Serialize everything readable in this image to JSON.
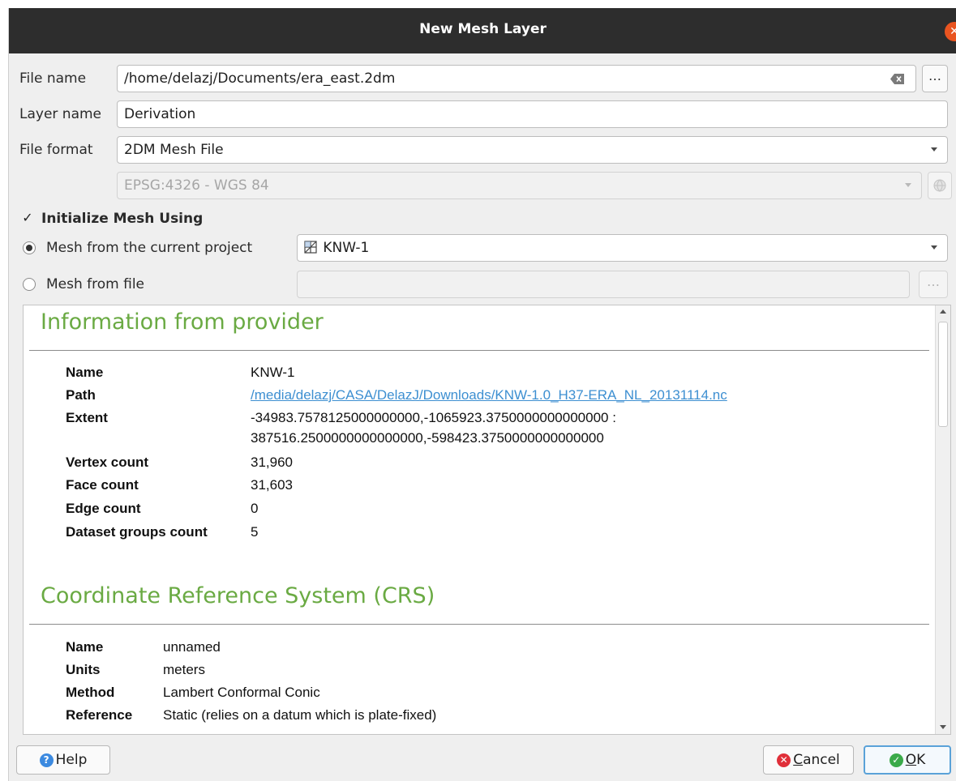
{
  "window": {
    "title": "New Mesh Layer"
  },
  "form": {
    "file_name_label": "File name",
    "file_name_value": "/home/delazj/Documents/era_east.2dm",
    "browse_label": "…",
    "layer_name_label": "Layer name",
    "layer_name_value": "Derivation",
    "file_format_label": "File format",
    "file_format_value": "2DM Mesh File",
    "crs_value": "EPSG:4326 - WGS 84",
    "initialize_label": "Initialize Mesh Using",
    "initialize_checked": true,
    "mesh_project_label": "Mesh from the current project",
    "mesh_project_value": "KNW-1",
    "mesh_file_label": "Mesh from file",
    "mesh_file_browse": "…",
    "checkbox_glyph": "✓"
  },
  "info": {
    "provider_title": "Information from provider",
    "provider_rows": [
      {
        "key": "Name",
        "value": "KNW-1"
      },
      {
        "key": "Path",
        "value": "/media/delazj/CASA/DelazJ/Downloads/KNW-1.0_H37-ERA_NL_20131114.nc"
      },
      {
        "key": "Extent",
        "value": "-34983.7578125000000000,-1065923.3750000000000000 :",
        "value2": "387516.2500000000000000,-598423.3750000000000000"
      },
      {
        "key": "Vertex count",
        "value": "31,960"
      },
      {
        "key": "Face count",
        "value": "31,603"
      },
      {
        "key": "Edge count",
        "value": "0"
      },
      {
        "key": "Dataset groups count",
        "value": "5"
      }
    ],
    "crs_title": "Coordinate Reference System (CRS)",
    "crs_rows": [
      {
        "key": "Name",
        "value": "unnamed"
      },
      {
        "key": "Units",
        "value": "meters"
      },
      {
        "key": "Method",
        "value": "Lambert Conformal Conic"
      },
      {
        "key": "Reference",
        "value": "Static (relies on a datum which is plate-fixed)"
      }
    ]
  },
  "buttons": {
    "help": "Help",
    "help_icon": "?",
    "cancel_prefix": "C",
    "cancel_rest": "ancel",
    "cancel_icon": "✕",
    "ok_prefix": "O",
    "ok_rest": "K",
    "ok_icon": "✓"
  },
  "colors": {
    "title_bar": "#2d2d2d",
    "close_button": "#e95420",
    "section_heading": "#6aaa43",
    "link": "#3d8fd1",
    "help_icon": "#3c8ae0",
    "cancel_icon": "#e0303a",
    "ok_icon": "#3aaa4a",
    "default_button_border": "#5aa2d8"
  }
}
